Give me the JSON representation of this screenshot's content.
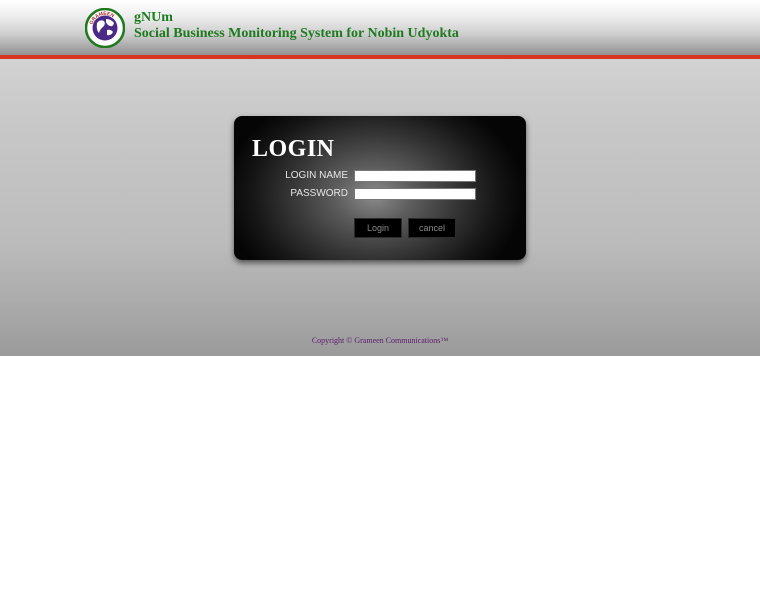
{
  "header": {
    "app_name": "gNUm",
    "app_subtitle": "Social Business Monitoring System for Nobin Udyokta",
    "logo_text": "GRAMEEN"
  },
  "login": {
    "title": "LOGIN",
    "login_name_label": "LOGIN NAME",
    "login_name_value": "",
    "password_label": "PASSWORD",
    "password_value": "",
    "login_button": "Login",
    "cancel_button": "cancel"
  },
  "footer": {
    "copyright": "Copyright © Grameen Communications™"
  },
  "colors": {
    "title_green": "#1e7a1e",
    "header_line_red": "#d8351f",
    "copyright_purple": "#5a1a6a"
  }
}
